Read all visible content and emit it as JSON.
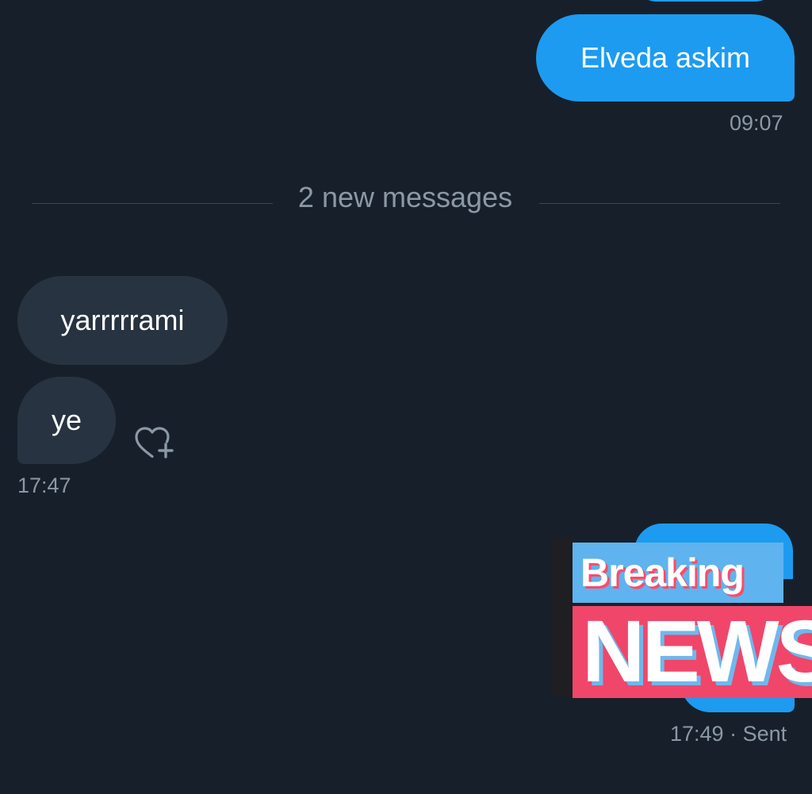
{
  "conversation": {
    "messages": [
      {
        "direction": "outgoing",
        "text": "Elveda askim"
      },
      {
        "direction": "incoming",
        "text": "yarrrrrami"
      },
      {
        "direction": "incoming",
        "text": "ye"
      }
    ],
    "timestamps": {
      "first_outgoing": "09:07",
      "incoming_group": "17:47",
      "last_outgoing": "17:49",
      "last_outgoing_status": "· Sent"
    },
    "divider": {
      "label": "2 new messages"
    },
    "sticker": {
      "line1": "Breaking",
      "line2": "NEWS"
    }
  },
  "icons": {
    "reaction": "heart-plus-icon"
  },
  "colors": {
    "background": "#17202a",
    "outgoing_bubble": "#1d9bf0",
    "incoming_bubble": "#273340",
    "muted_text": "#8b98a5",
    "sticker_red": "#f0466a",
    "sticker_blue": "#5fb3ee"
  }
}
